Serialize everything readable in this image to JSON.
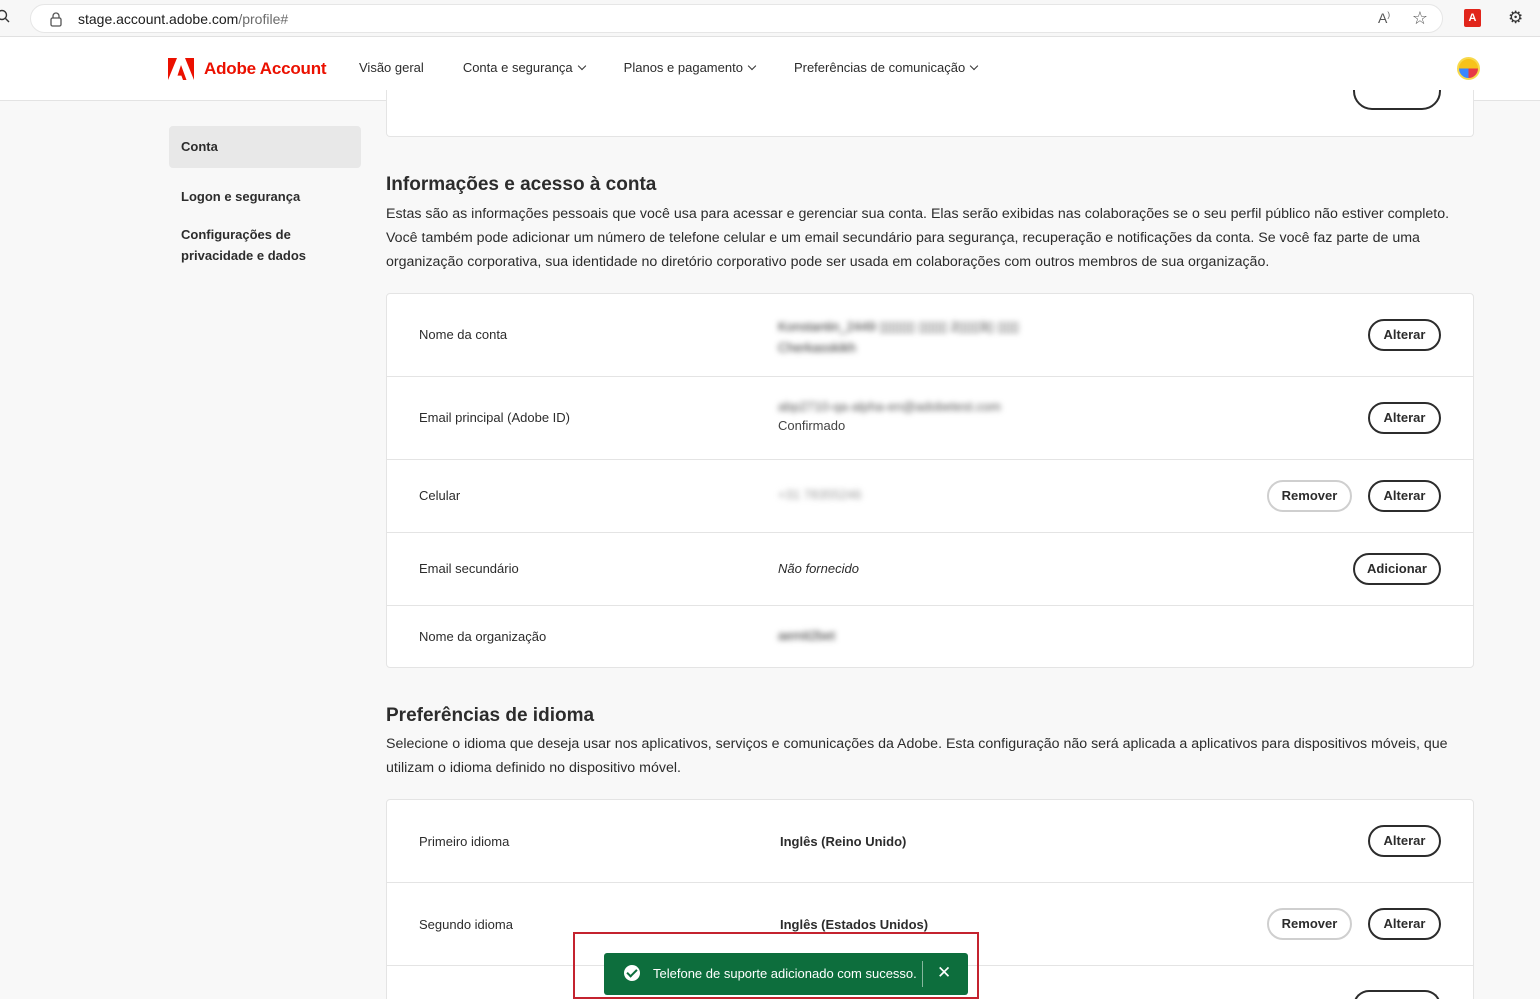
{
  "browser": {
    "url_host": "stage.account.adobe.com",
    "url_path": "/profile#"
  },
  "header": {
    "brand": "Adobe Account",
    "nav": [
      {
        "label": "Visão geral"
      },
      {
        "label": "Conta e segurança"
      },
      {
        "label": "Planos e pagamento"
      },
      {
        "label": "Preferências de comunicação"
      }
    ]
  },
  "sidebar": {
    "items": [
      {
        "label": "Conta"
      },
      {
        "label": "Logon e segurança"
      },
      {
        "label": "Configurações de privacidade e dados"
      }
    ]
  },
  "account_info": {
    "title": "Informações e acesso à conta",
    "description": "Estas são as informações pessoais que você usa para acessar e gerenciar sua conta. Elas serão exibidas nas colaborações se o seu perfil público não estiver completo. Você também pode adicionar um número de telefone celular e um email secundário para segurança, recuperação e notificações da conta. Se você faz parte de uma organização corporativa, sua identidade no diretório corporativo pode ser usada em colaborações com outros membros de sua organização.",
    "rows": [
      {
        "label": "Nome da conta",
        "value": "Konstantin_2449 ▯▯▯▯▯ ▯▯▯▯ 2▯▯▯3▯ ▯▯▯",
        "value2": "Cherkasskikh",
        "change": "Alterar"
      },
      {
        "label": "Email principal (Adobe ID)",
        "value": "abp2710-qa-alpha-en@adobetest.com",
        "status": "Confirmado",
        "change": "Alterar"
      },
      {
        "label": "Celular",
        "value": "+31 78355246",
        "remove": "Remover",
        "change": "Alterar"
      },
      {
        "label": "Email secundário",
        "value": "Não fornecido",
        "add": "Adicionar"
      },
      {
        "label": "Nome da organização",
        "value": "aemit2bet"
      }
    ]
  },
  "language": {
    "title": "Preferências de idioma",
    "description": "Selecione o idioma que deseja usar nos aplicativos, serviços e comunicações da Adobe. Esta configuração não será aplicada a aplicativos para dispositivos móveis, que utilizam o idioma definido no dispositivo móvel.",
    "rows": [
      {
        "label": "Primeiro idioma",
        "value": "Inglês (Reino Unido)",
        "change": "Alterar"
      },
      {
        "label": "Segundo idioma",
        "value": "Inglês (Estados Unidos)",
        "remove": "Remover",
        "change": "Alterar"
      }
    ]
  },
  "toast": {
    "message": "Telefone de suporte adicionado com sucesso.",
    "close": "✕",
    "color": "#0d6e3d"
  }
}
